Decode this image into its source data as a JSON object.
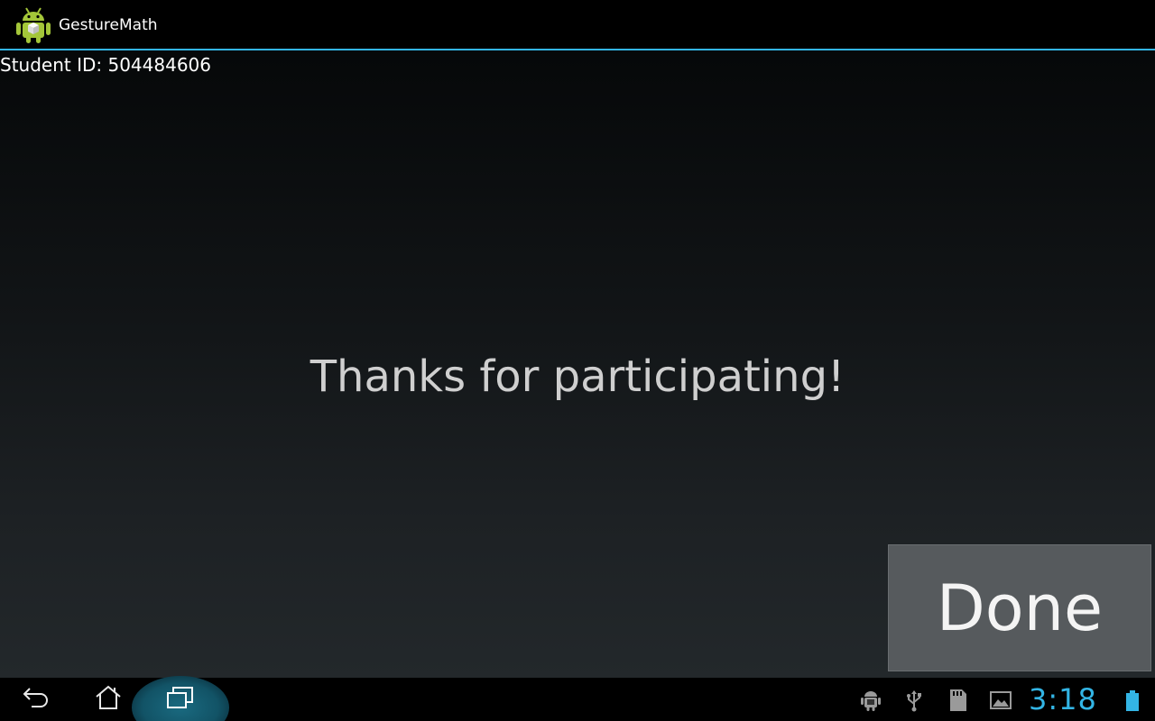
{
  "action_bar": {
    "app_name": "GestureMath",
    "app_icon": "android-robot-icon",
    "accent_color": "#33b5e5"
  },
  "content": {
    "student_id_label": "Student ID: 504484606",
    "message": "Thanks for participating!",
    "done_button_label": "Done"
  },
  "system_bar": {
    "nav": [
      "back-icon",
      "home-icon",
      "recent-apps-icon"
    ],
    "status_icons": [
      "android-debug-icon",
      "usb-icon",
      "sd-card-icon",
      "screenshot-icon",
      "battery-icon"
    ],
    "clock": "3:18",
    "clock_color": "#33b5e5"
  }
}
